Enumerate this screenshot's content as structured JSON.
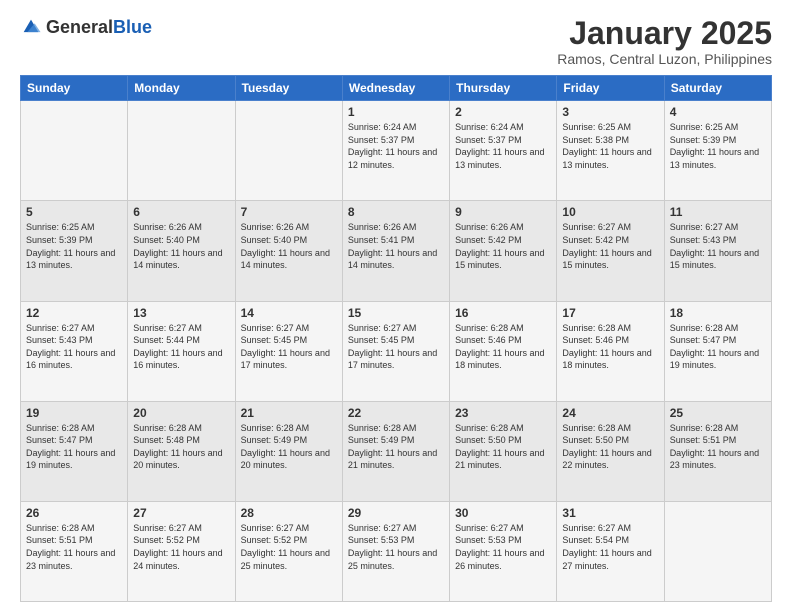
{
  "header": {
    "logo_general": "General",
    "logo_blue": "Blue",
    "month_title": "January 2025",
    "subtitle": "Ramos, Central Luzon, Philippines"
  },
  "weekdays": [
    "Sunday",
    "Monday",
    "Tuesday",
    "Wednesday",
    "Thursday",
    "Friday",
    "Saturday"
  ],
  "weeks": [
    [
      {
        "day": "",
        "sunrise": "",
        "sunset": "",
        "daylight": ""
      },
      {
        "day": "",
        "sunrise": "",
        "sunset": "",
        "daylight": ""
      },
      {
        "day": "",
        "sunrise": "",
        "sunset": "",
        "daylight": ""
      },
      {
        "day": "1",
        "sunrise": "Sunrise: 6:24 AM",
        "sunset": "Sunset: 5:37 PM",
        "daylight": "Daylight: 11 hours and 12 minutes."
      },
      {
        "day": "2",
        "sunrise": "Sunrise: 6:24 AM",
        "sunset": "Sunset: 5:37 PM",
        "daylight": "Daylight: 11 hours and 13 minutes."
      },
      {
        "day": "3",
        "sunrise": "Sunrise: 6:25 AM",
        "sunset": "Sunset: 5:38 PM",
        "daylight": "Daylight: 11 hours and 13 minutes."
      },
      {
        "day": "4",
        "sunrise": "Sunrise: 6:25 AM",
        "sunset": "Sunset: 5:39 PM",
        "daylight": "Daylight: 11 hours and 13 minutes."
      }
    ],
    [
      {
        "day": "5",
        "sunrise": "Sunrise: 6:25 AM",
        "sunset": "Sunset: 5:39 PM",
        "daylight": "Daylight: 11 hours and 13 minutes."
      },
      {
        "day": "6",
        "sunrise": "Sunrise: 6:26 AM",
        "sunset": "Sunset: 5:40 PM",
        "daylight": "Daylight: 11 hours and 14 minutes."
      },
      {
        "day": "7",
        "sunrise": "Sunrise: 6:26 AM",
        "sunset": "Sunset: 5:40 PM",
        "daylight": "Daylight: 11 hours and 14 minutes."
      },
      {
        "day": "8",
        "sunrise": "Sunrise: 6:26 AM",
        "sunset": "Sunset: 5:41 PM",
        "daylight": "Daylight: 11 hours and 14 minutes."
      },
      {
        "day": "9",
        "sunrise": "Sunrise: 6:26 AM",
        "sunset": "Sunset: 5:42 PM",
        "daylight": "Daylight: 11 hours and 15 minutes."
      },
      {
        "day": "10",
        "sunrise": "Sunrise: 6:27 AM",
        "sunset": "Sunset: 5:42 PM",
        "daylight": "Daylight: 11 hours and 15 minutes."
      },
      {
        "day": "11",
        "sunrise": "Sunrise: 6:27 AM",
        "sunset": "Sunset: 5:43 PM",
        "daylight": "Daylight: 11 hours and 15 minutes."
      }
    ],
    [
      {
        "day": "12",
        "sunrise": "Sunrise: 6:27 AM",
        "sunset": "Sunset: 5:43 PM",
        "daylight": "Daylight: 11 hours and 16 minutes."
      },
      {
        "day": "13",
        "sunrise": "Sunrise: 6:27 AM",
        "sunset": "Sunset: 5:44 PM",
        "daylight": "Daylight: 11 hours and 16 minutes."
      },
      {
        "day": "14",
        "sunrise": "Sunrise: 6:27 AM",
        "sunset": "Sunset: 5:45 PM",
        "daylight": "Daylight: 11 hours and 17 minutes."
      },
      {
        "day": "15",
        "sunrise": "Sunrise: 6:27 AM",
        "sunset": "Sunset: 5:45 PM",
        "daylight": "Daylight: 11 hours and 17 minutes."
      },
      {
        "day": "16",
        "sunrise": "Sunrise: 6:28 AM",
        "sunset": "Sunset: 5:46 PM",
        "daylight": "Daylight: 11 hours and 18 minutes."
      },
      {
        "day": "17",
        "sunrise": "Sunrise: 6:28 AM",
        "sunset": "Sunset: 5:46 PM",
        "daylight": "Daylight: 11 hours and 18 minutes."
      },
      {
        "day": "18",
        "sunrise": "Sunrise: 6:28 AM",
        "sunset": "Sunset: 5:47 PM",
        "daylight": "Daylight: 11 hours and 19 minutes."
      }
    ],
    [
      {
        "day": "19",
        "sunrise": "Sunrise: 6:28 AM",
        "sunset": "Sunset: 5:47 PM",
        "daylight": "Daylight: 11 hours and 19 minutes."
      },
      {
        "day": "20",
        "sunrise": "Sunrise: 6:28 AM",
        "sunset": "Sunset: 5:48 PM",
        "daylight": "Daylight: 11 hours and 20 minutes."
      },
      {
        "day": "21",
        "sunrise": "Sunrise: 6:28 AM",
        "sunset": "Sunset: 5:49 PM",
        "daylight": "Daylight: 11 hours and 20 minutes."
      },
      {
        "day": "22",
        "sunrise": "Sunrise: 6:28 AM",
        "sunset": "Sunset: 5:49 PM",
        "daylight": "Daylight: 11 hours and 21 minutes."
      },
      {
        "day": "23",
        "sunrise": "Sunrise: 6:28 AM",
        "sunset": "Sunset: 5:50 PM",
        "daylight": "Daylight: 11 hours and 21 minutes."
      },
      {
        "day": "24",
        "sunrise": "Sunrise: 6:28 AM",
        "sunset": "Sunset: 5:50 PM",
        "daylight": "Daylight: 11 hours and 22 minutes."
      },
      {
        "day": "25",
        "sunrise": "Sunrise: 6:28 AM",
        "sunset": "Sunset: 5:51 PM",
        "daylight": "Daylight: 11 hours and 23 minutes."
      }
    ],
    [
      {
        "day": "26",
        "sunrise": "Sunrise: 6:28 AM",
        "sunset": "Sunset: 5:51 PM",
        "daylight": "Daylight: 11 hours and 23 minutes."
      },
      {
        "day": "27",
        "sunrise": "Sunrise: 6:27 AM",
        "sunset": "Sunset: 5:52 PM",
        "daylight": "Daylight: 11 hours and 24 minutes."
      },
      {
        "day": "28",
        "sunrise": "Sunrise: 6:27 AM",
        "sunset": "Sunset: 5:52 PM",
        "daylight": "Daylight: 11 hours and 25 minutes."
      },
      {
        "day": "29",
        "sunrise": "Sunrise: 6:27 AM",
        "sunset": "Sunset: 5:53 PM",
        "daylight": "Daylight: 11 hours and 25 minutes."
      },
      {
        "day": "30",
        "sunrise": "Sunrise: 6:27 AM",
        "sunset": "Sunset: 5:53 PM",
        "daylight": "Daylight: 11 hours and 26 minutes."
      },
      {
        "day": "31",
        "sunrise": "Sunrise: 6:27 AM",
        "sunset": "Sunset: 5:54 PM",
        "daylight": "Daylight: 11 hours and 27 minutes."
      },
      {
        "day": "",
        "sunrise": "",
        "sunset": "",
        "daylight": ""
      }
    ]
  ]
}
